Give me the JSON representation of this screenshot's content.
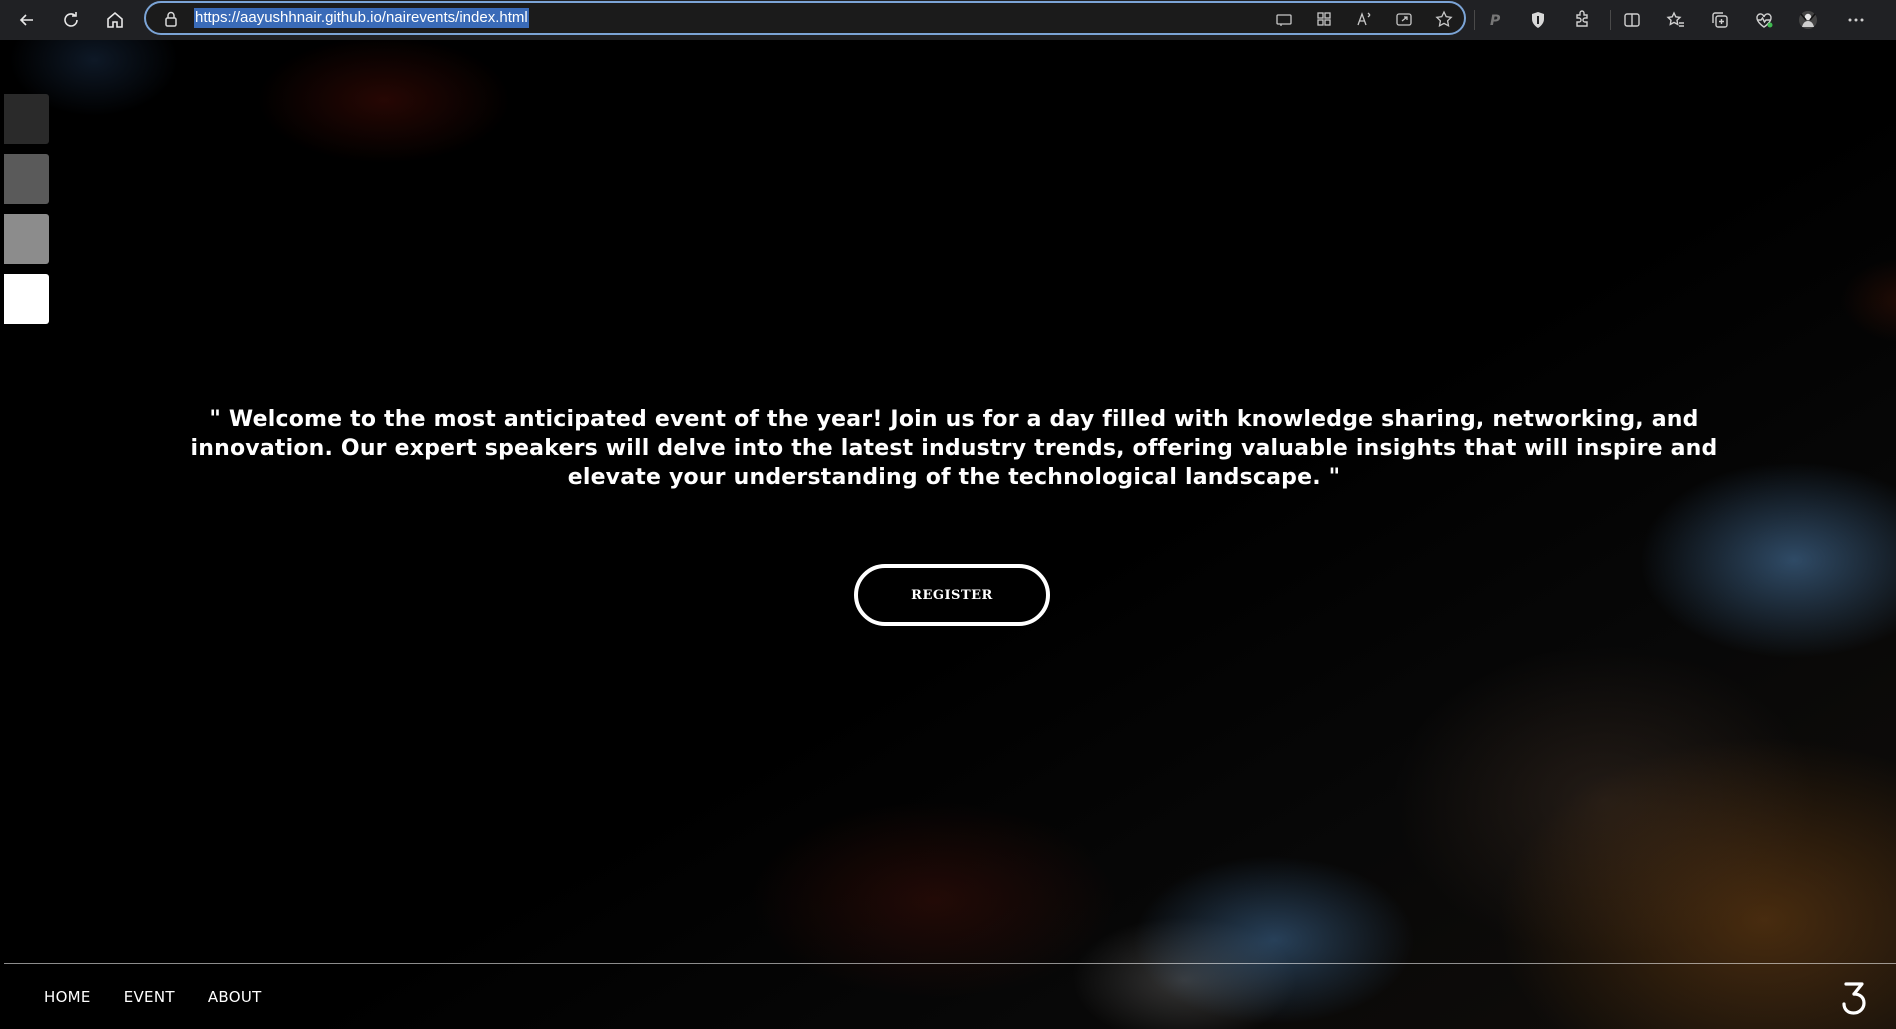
{
  "browser": {
    "url": "https://aayushhnair.github.io/nairevents/index.html",
    "back_icon": "back-arrow-icon",
    "refresh_icon": "refresh-icon",
    "home_icon": "home-icon",
    "lock_icon": "lock-icon",
    "address_icons": [
      "app-available-icon",
      "grid-icon",
      "read-aloud-icon",
      "share-icon",
      "favorite-star-icon"
    ],
    "toolbar_icons": [
      "p-extension-icon",
      "shield-extension-icon",
      "extensions-icon",
      "split-screen-icon",
      "favorites-icon",
      "collections-icon",
      "heartbeat-icon",
      "profile-avatar-icon",
      "more-menu-icon"
    ]
  },
  "page": {
    "swatches": [
      "#2a2a2a",
      "#5a5a5a",
      "#8c8c8c",
      "#ffffff"
    ],
    "hero_text": "\" Welcome to the most anticipated event of the year! Join us for a day filled with knowledge sharing, networking, and innovation. Our expert speakers will delve into the latest industry trends, offering valuable insights that will inspire and elevate your understanding of the technological landscape. \"",
    "register_label": "REGISTER",
    "footer": {
      "nav": [
        "HOME",
        "EVENT",
        "ABOUT"
      ],
      "logo_icon": "brand-logo-icon"
    }
  },
  "colors": {
    "background": "#000000",
    "address_border": "#7ba4d6",
    "url_highlight": "#3a6bb8",
    "text": "#ffffff"
  }
}
